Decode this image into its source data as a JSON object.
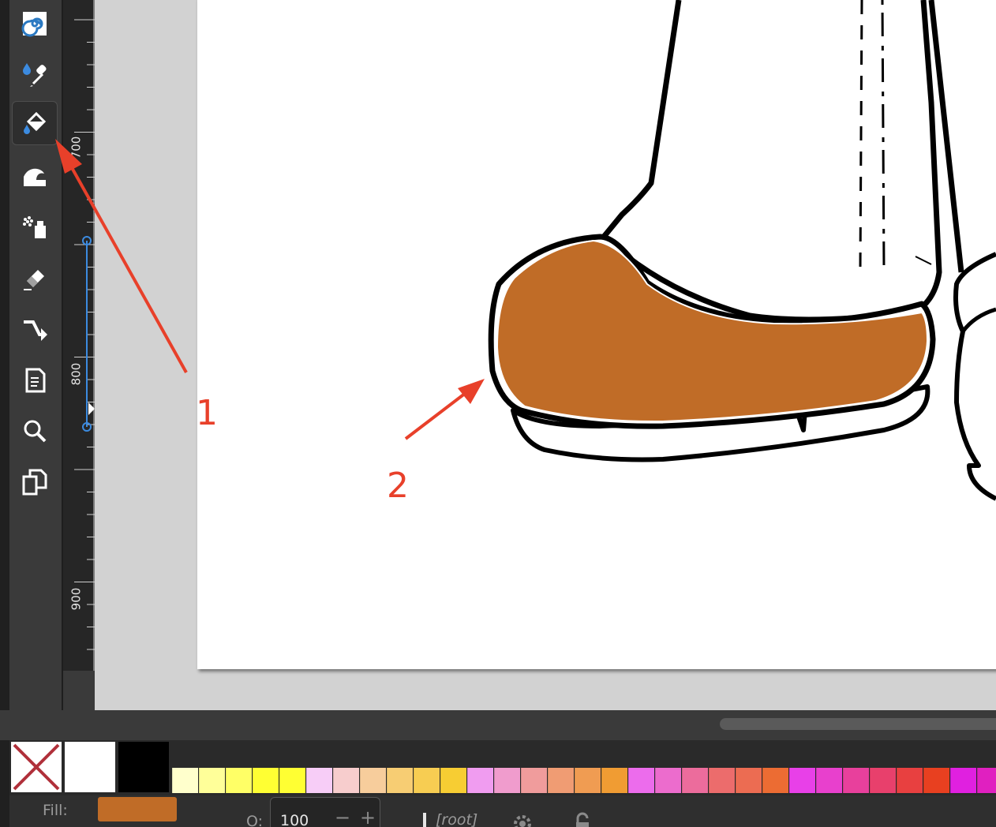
{
  "toolbox": {
    "tools": [
      {
        "name": "spiral-tool",
        "icon": "spiral-icon"
      },
      {
        "name": "dropper-tool",
        "icon": "dropper-icon"
      },
      {
        "name": "paint-bucket-tool",
        "icon": "paint-bucket-icon",
        "active": true
      },
      {
        "name": "tweak-tool",
        "icon": "tweak-icon"
      },
      {
        "name": "spray-tool",
        "icon": "spray-icon"
      },
      {
        "name": "eraser-tool",
        "icon": "eraser-icon"
      },
      {
        "name": "connector-tool",
        "icon": "connector-icon"
      },
      {
        "name": "pages-tool",
        "icon": "pages-icon"
      },
      {
        "name": "zoom-tool",
        "icon": "zoom-icon"
      },
      {
        "name": "clone-tool",
        "icon": "clone-icon"
      }
    ]
  },
  "ruler": {
    "labels": [
      "700",
      "800",
      "900"
    ]
  },
  "canvas": {
    "shoe_fill": "#c06c27",
    "stroke": "#000000"
  },
  "annotations": {
    "label_1": "1",
    "label_2": "2",
    "color": "#e8402a"
  },
  "palette": {
    "none_label": "no-paint",
    "white": "#ffffff",
    "black": "#000000",
    "swatches": [
      "#ffffcc",
      "#ffff99",
      "#ffff66",
      "#ffff33",
      "#ffff33",
      "#f7cdf7",
      "#f7cdcd",
      "#f7cd9c",
      "#f7cd73",
      "#f7cd52",
      "#f7cd33",
      "#f09cf0",
      "#f09ccd",
      "#f09c9c",
      "#f09c73",
      "#f09c52",
      "#f09c33",
      "#ec6cec",
      "#ec6ccd",
      "#ec6c9c",
      "#ec6c6c",
      "#ec6c52",
      "#ec6c33",
      "#e840e8",
      "#e840cd",
      "#e8409c",
      "#e8406c",
      "#e84040",
      "#e84020",
      "#e020e0",
      "#e020c0"
    ]
  },
  "status": {
    "fill_label": "Fill:",
    "fill_color": "#c06c27",
    "opacity_label": "O:",
    "opacity_value": "100",
    "minus": "−",
    "plus": "+",
    "layer": "[root]"
  }
}
